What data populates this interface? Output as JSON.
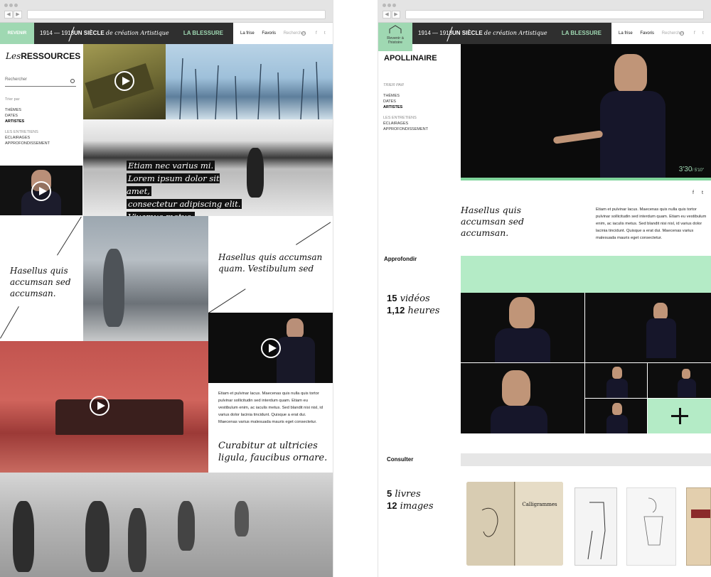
{
  "left": {
    "header": {
      "back": "REVENIR",
      "years": "1914 — 1918",
      "title_bold": "UN SIÈCLE",
      "title_italic": "de création Artistique",
      "category": "LA BLESSURE",
      "menu": [
        "La frise",
        "Favoris"
      ],
      "search": "Rechercher"
    },
    "sidebar": {
      "title_italic": "Les",
      "title": "RESSOURCES",
      "search_placeholder": "Rechercher",
      "sort_label": "Trier par",
      "sort_items": [
        "THÈMES",
        "DATES",
        "ARTISTES"
      ],
      "type_items": [
        "LES ENTRETIENS",
        "ÉCLAIRAGES",
        "APPROFONDISSEMENT"
      ]
    },
    "headline": [
      "Etiam nec varius mi.",
      "Lorem ipsum dolor sit amet,",
      "consectetur adipiscing elit.",
      "Vivamus metus."
    ],
    "quote1": "Hasellus quis accumsan sed accumsan.",
    "quote2": "Hasellus quis accumsan quam. Vestibulum sed",
    "paragraph": "Etiam et pulvinar lacus. Maecenas quis nulla quis tortor pulvinar sollicitudin sed interdum quam. Etiam eu vestibulum enim, ac iaculis metus. Sed blandit nisi nisl, id varius dolor lacinia tincidunt. Quisque a erat dui. Maecenas varius malesuada mauris eget consectetur.",
    "quote3": "Curabitur at ultricies ligula, faucibus ornare."
  },
  "right": {
    "header": {
      "back": "Revenir à l'histoire",
      "years": "1914 — 1918",
      "title_bold": "UN SIÈCLE",
      "title_italic": "de création Artistique",
      "category": "LA BLESSURE",
      "menu": [
        "La frise",
        "Favoris"
      ],
      "search": "Rechercher"
    },
    "sidebar": {
      "title": "APOLLINAIRE",
      "sort_label": "TRIER PAR",
      "sort_items": [
        "THÈMES",
        "DATES",
        "ARTISTES"
      ],
      "type_items": [
        "LES ENTRETIENS",
        "ÉCLAIRAGES",
        "APPROFONDISSEMENT"
      ]
    },
    "video": {
      "time": "3'30",
      "duration": "/ 5'10\"",
      "progress": 1.0
    },
    "quote": "Hasellus quis accumsan sed accumsan.",
    "paragraph": "Etiam et pulvinar lacus. Maecenas quis nulla quis tortor pulvinar sollicitudin sed interdum quam. Etiam eu vestibulum enim, ac iaculis metus. Sed blandit nisi nisl, id varius dolor lacinia tincidunt. Quisque a erat dui. Maecenas varius malesuada mauris eget consectetur.",
    "approfondir": {
      "label": "Approfondir",
      "videos_n": "15",
      "videos_t": "vidéos",
      "hours_n": "1,12",
      "hours_t": "heures"
    },
    "consulter": {
      "label": "Consulter",
      "books_n": "5",
      "books_t": "livres",
      "images_n": "12",
      "images_t": "images",
      "book_title": "Calligrammes"
    }
  },
  "colors": {
    "accent": "#9fd8b2",
    "mint": "#b4ebc6",
    "dark": "#2f2f2f",
    "red": "#c5524d"
  }
}
